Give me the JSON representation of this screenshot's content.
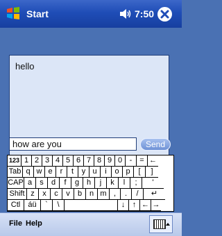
{
  "titlebar": {
    "app_title": "Start",
    "time": "7:50",
    "icons": [
      "windows-flag-icon",
      "speaker-icon",
      "close-icon"
    ]
  },
  "chat": {
    "message_text": "hello",
    "input_value": "how are you",
    "send_label": "Send"
  },
  "keyboard": {
    "rows": [
      [
        "123",
        "1",
        "2",
        "3",
        "4",
        "5",
        "6",
        "7",
        "8",
        "9",
        "0",
        "-",
        "=",
        "←"
      ],
      [
        "Tab",
        "q",
        "w",
        "e",
        "r",
        "t",
        "y",
        "u",
        "i",
        "o",
        "p",
        "[",
        "]"
      ],
      [
        "CAP",
        "a",
        "s",
        "d",
        "f",
        "g",
        "h",
        "j",
        "k",
        "l",
        ";",
        "'"
      ],
      [
        "Shift",
        "z",
        "x",
        "c",
        "v",
        "b",
        "n",
        "m",
        ",",
        ".",
        "/",
        "↵"
      ],
      [
        "Ctl",
        "áü",
        "`",
        "\\",
        "",
        "↓",
        "↑",
        "←",
        "→"
      ]
    ]
  },
  "menubar": {
    "file_label": "File",
    "help_label": "Help",
    "sip_icon": "keyboard-icon"
  },
  "colors": {
    "titlebar": "#1f4db7",
    "body_bg": "#4a71b3",
    "panel_bg": "#dce6f7"
  }
}
